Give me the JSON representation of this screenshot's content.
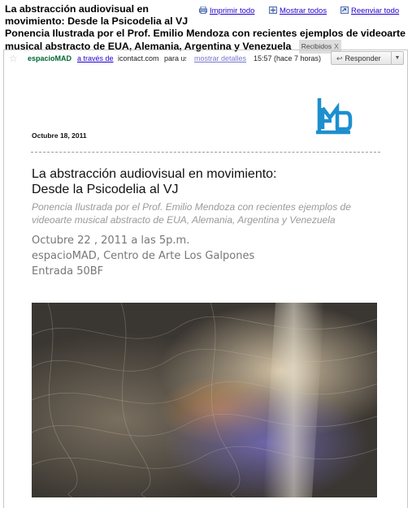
{
  "subject": {
    "line1": "La abstracción audiovisual en movimiento: Desde la Psicodelia al VJ",
    "line2": "Ponencia Ilustrada por el Prof. Emilio Mendoza con recientes ejemplos de videoarte musical abstracto de EUA, Alemania, Argentina y Venezuela",
    "label": "Recibidos",
    "label_close": "X"
  },
  "actions": {
    "print": "Imprimir todo",
    "expand": "Mostrar todos",
    "forward": "Reenviar todo"
  },
  "message": {
    "from_name": "espacioMAD",
    "via": "a través de",
    "domain": "icontact.com",
    "to_prefix": "para usted",
    "details": "mostrar detalles",
    "time": "15:57 (hace 7 horas)",
    "reply": "Responder"
  },
  "body": {
    "date": "Octubre 18, 2011",
    "title_line1": "La abstracción audiovisual en movimiento:",
    "title_line2": "Desde la Psicodelia al VJ",
    "subtitle": "Ponencia Ilustrada por el Prof. Emilio Mendoza con recientes ejemplos de videoarte musical abstracto de EUA, Alemania, Argentina y Venezuela",
    "when": "Octubre 22 , 2011 a las 5p.m.",
    "where": "espacioMAD, Centro de Arte Los Galpones",
    "entry": "Entrada 50BF"
  },
  "colors": {
    "link": "#2200cc",
    "sender": "#006633",
    "logo": "#1d8fcf"
  },
  "icons": [
    "printer-icon",
    "expand-icon",
    "forward-icon",
    "star-icon",
    "reply-arrow-icon",
    "dropdown-icon"
  ]
}
